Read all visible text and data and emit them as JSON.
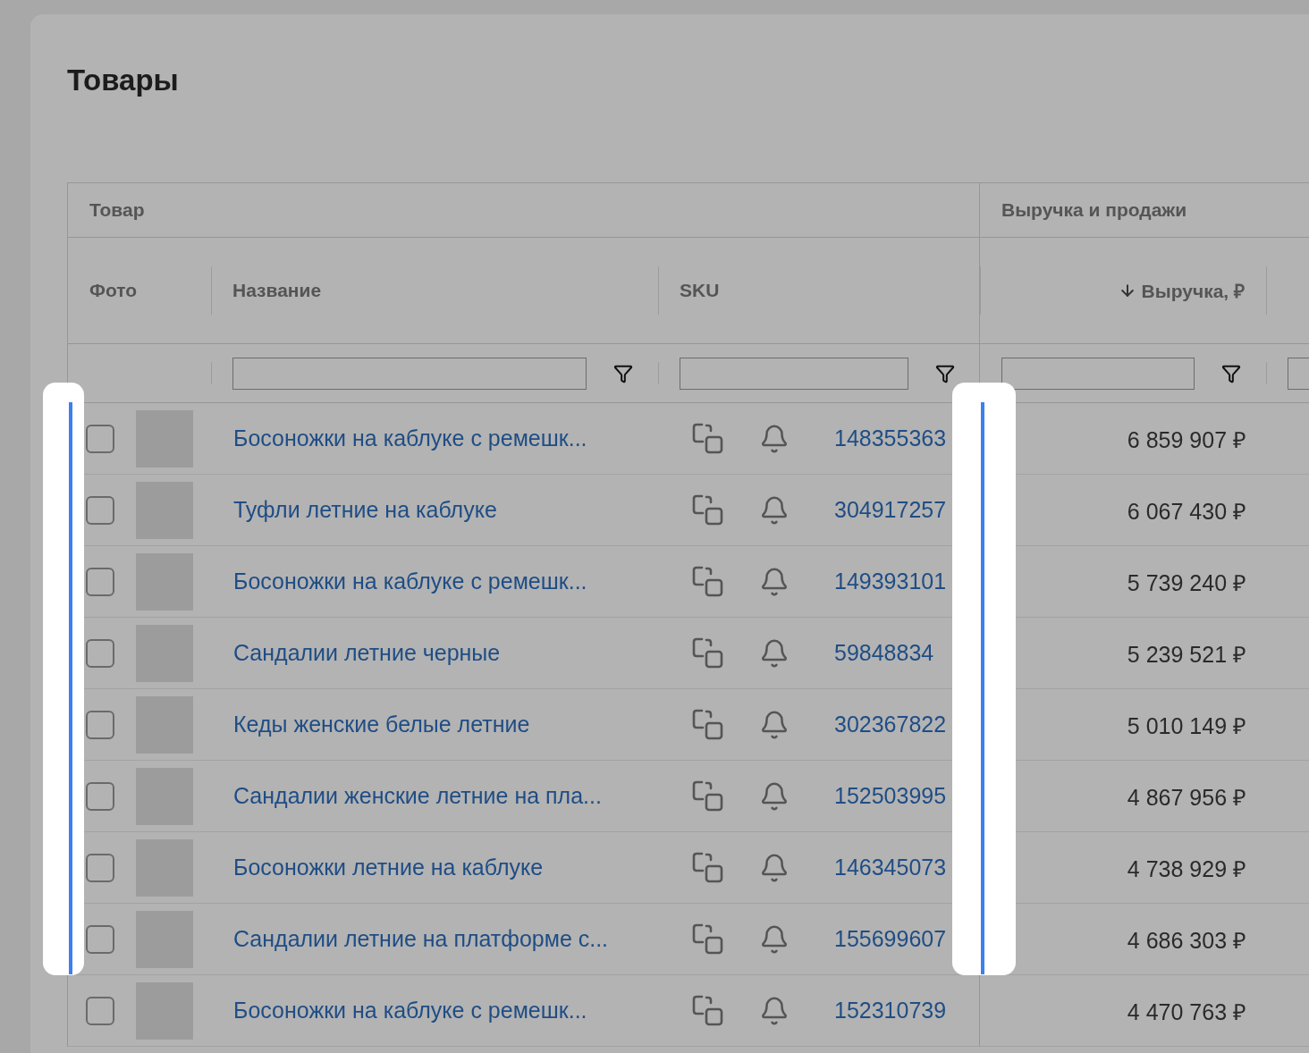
{
  "page": {
    "title": "Товары"
  },
  "table": {
    "groups": [
      {
        "label": "Товар"
      },
      {
        "label": "Выручка и продажи"
      }
    ],
    "columns": [
      {
        "label": "Фото"
      },
      {
        "label": "Название"
      },
      {
        "label": "SKU"
      },
      {
        "label": "Выручка, ₽",
        "sorted": true
      }
    ],
    "rows": [
      {
        "name": "Босоножки на каблуке с ремешк...",
        "sku": "148355363",
        "revenue": "6 859 907 ₽",
        "checked": false,
        "highlighted": true
      },
      {
        "name": "Туфли летние на каблуке",
        "sku": "304917257",
        "revenue": "6 067 430 ₽",
        "checked": false,
        "highlighted": true
      },
      {
        "name": "Босоножки на каблуке с ремешк...",
        "sku": "149393101",
        "revenue": "5 739 240 ₽",
        "checked": false,
        "highlighted": true
      },
      {
        "name": "Сандалии летние черные",
        "sku": "59848834",
        "revenue": "5 239 521 ₽",
        "checked": false,
        "highlighted": true
      },
      {
        "name": "Кеды женские белые летние",
        "sku": "302367822",
        "revenue": "5 010 149 ₽",
        "checked": false,
        "highlighted": true
      },
      {
        "name": "Сандалии женские летние на пла...",
        "sku": "152503995",
        "revenue": "4 867 956 ₽",
        "checked": false,
        "highlighted": true
      },
      {
        "name": "Босоножки летние на каблуке",
        "sku": "146345073",
        "revenue": "4 738 929 ₽",
        "checked": false,
        "highlighted": true
      },
      {
        "name": "Сандалии летние на платформе с...",
        "sku": "155699607",
        "revenue": "4 686 303 ₽",
        "checked": false,
        "highlighted": true
      },
      {
        "name": "Босоножки на каблуке с ремешк...",
        "sku": "152310739",
        "revenue": "4 470 763 ₽",
        "checked": false,
        "highlighted": false
      }
    ]
  }
}
